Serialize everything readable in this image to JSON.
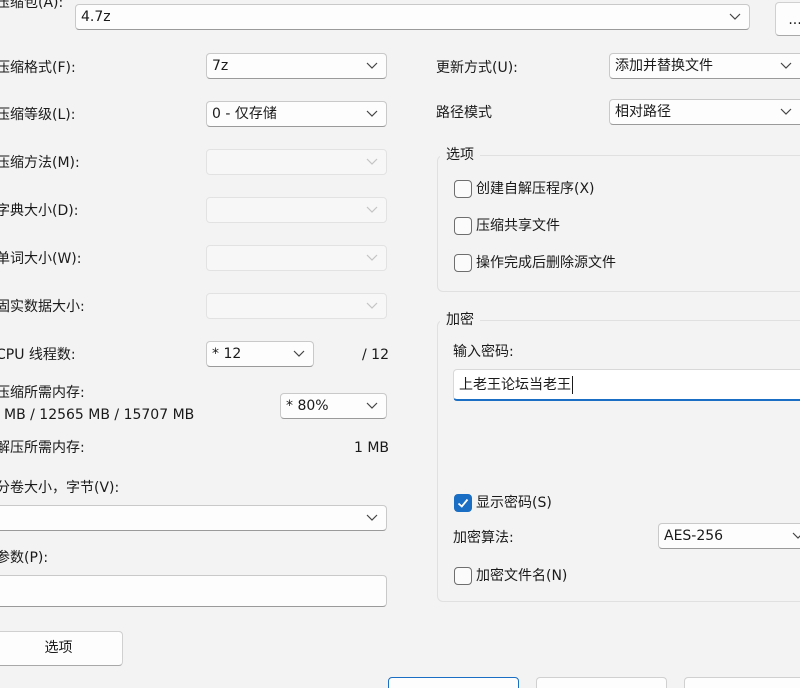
{
  "archive": {
    "label": "压缩包(A):",
    "value": "4.7z",
    "browse_label": "..."
  },
  "left": {
    "format": {
      "label": "压缩格式(F):",
      "value": "7z"
    },
    "level": {
      "label": "压缩等级(L):",
      "value": "0 - 仅存储"
    },
    "method": {
      "label": "压缩方法(M):",
      "value": ""
    },
    "dict": {
      "label": "字典大小(D):",
      "value": ""
    },
    "word": {
      "label": "单词大小(W):",
      "value": ""
    },
    "solid": {
      "label": "固实数据大小:",
      "value": ""
    },
    "threads": {
      "label": "CPU 线程数:",
      "value": "* 12",
      "max": "/ 12"
    },
    "memory": {
      "label": "压缩所需内存:",
      "detail": "MB / 12565 MB / 15707 MB",
      "value": "* 80%"
    },
    "decompress": {
      "label": "解压所需内存:",
      "value": "1 MB"
    },
    "volume": {
      "label": "分卷大小，字节(V):",
      "value": ""
    },
    "params": {
      "label": "参数(P):",
      "value": ""
    },
    "options_button": "选项"
  },
  "right": {
    "update": {
      "label": "更新方式(U):",
      "value": "添加并替换文件"
    },
    "path": {
      "label": "路径模式",
      "value": "相对路径"
    },
    "options_group": {
      "title": "选项",
      "items": [
        {
          "label": "创建自解压程序(X)",
          "checked": false
        },
        {
          "label": "压缩共享文件",
          "checked": false
        },
        {
          "label": "操作完成后删除源文件",
          "checked": false
        }
      ]
    },
    "encryption": {
      "title": "加密",
      "password_label": "输入密码:",
      "password_value": "上老王论坛当老王",
      "show_password": {
        "label": "显示密码(S)",
        "checked": true
      },
      "method_label": "加密算法:",
      "method_value": "AES-256",
      "encrypt_names": {
        "label": "加密文件名(N)",
        "checked": false
      }
    }
  },
  "colors": {
    "accent": "#1a6ec4",
    "background": "#f3f3f3"
  }
}
